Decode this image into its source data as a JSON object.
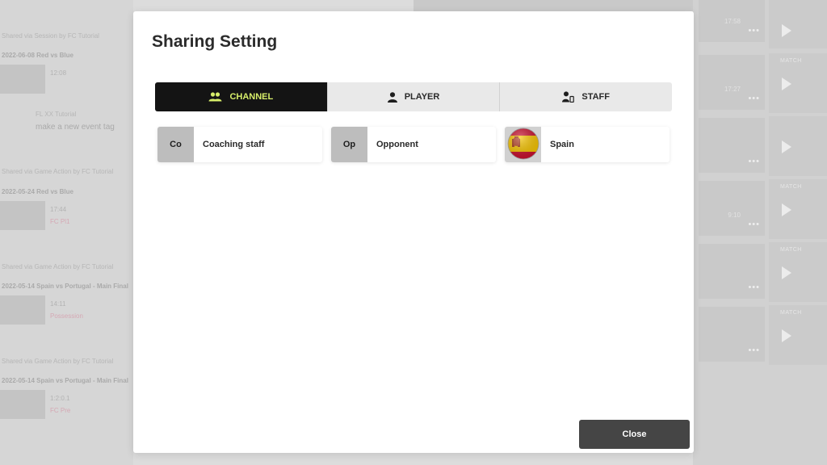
{
  "modal": {
    "title": "Sharing Setting",
    "tabs": [
      {
        "label": "CHANNEL",
        "icon": "group-icon",
        "active": true
      },
      {
        "label": "PLAYER",
        "icon": "person-icon",
        "active": false
      },
      {
        "label": "STAFF",
        "icon": "staff-icon",
        "active": false
      }
    ],
    "channels": [
      {
        "avatar": "Co",
        "name": "Coaching staff"
      },
      {
        "avatar": "Op",
        "name": "Opponent"
      },
      {
        "avatar_icon": "spain-flag-icon",
        "name": "Spain"
      }
    ],
    "close_label": "Close"
  },
  "background": {
    "rows": [
      {
        "label": "Shared via Session by FC Tutorial",
        "title": "2022-06-08 Red vs Blue",
        "time": "12:08"
      },
      {
        "author": "FL   XX Tutorial",
        "text": "make a new event tag"
      },
      {
        "label": "Shared via Game Action by FC Tutorial",
        "title": "2022-05-24 Red vs Blue",
        "time": "17:44",
        "tag": "FC Pl1"
      },
      {
        "label": "Shared via Game Action by FC Tutorial",
        "title": "2022-05-14 Spain vs Portugal - Main Final",
        "time": "14:11",
        "tag": "Possession"
      },
      {
        "label": "Shared via Game Action by FC Tutorial",
        "title": "2022-05-14 Spain vs Portugal - Main Final",
        "time": "1:2:0.1",
        "tag": "FC Pre"
      }
    ],
    "card_times": [
      "17:58",
      "17:27",
      "9:10"
    ],
    "side_label": "MATCH"
  },
  "colors": {
    "active_tab_bg": "#141414",
    "active_tab_text": "#d7ee6a",
    "close_button_bg": "#454545"
  }
}
